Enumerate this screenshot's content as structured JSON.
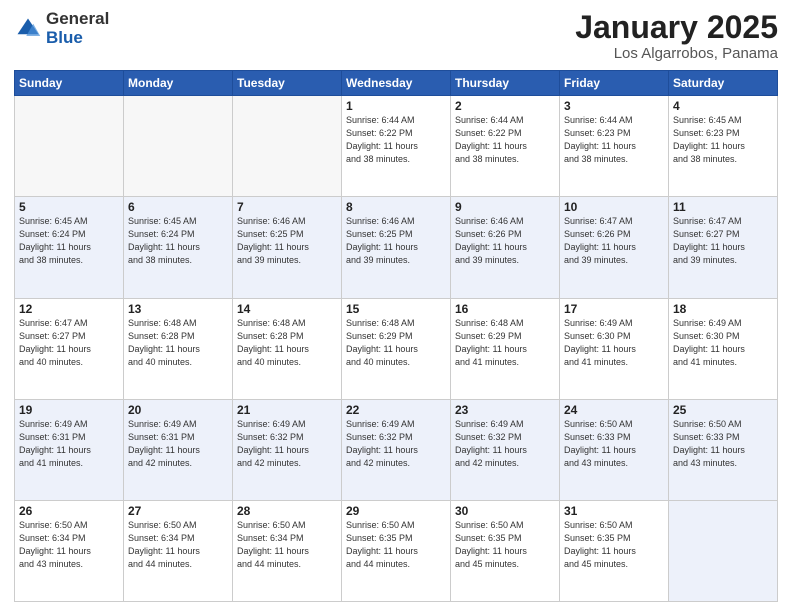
{
  "header": {
    "logo_general": "General",
    "logo_blue": "Blue",
    "title": "January 2025",
    "subtitle": "Los Algarrobos, Panama"
  },
  "days_of_week": [
    "Sunday",
    "Monday",
    "Tuesday",
    "Wednesday",
    "Thursday",
    "Friday",
    "Saturday"
  ],
  "weeks": [
    [
      {
        "day": "",
        "info": ""
      },
      {
        "day": "",
        "info": ""
      },
      {
        "day": "",
        "info": ""
      },
      {
        "day": "1",
        "info": "Sunrise: 6:44 AM\nSunset: 6:22 PM\nDaylight: 11 hours\nand 38 minutes."
      },
      {
        "day": "2",
        "info": "Sunrise: 6:44 AM\nSunset: 6:22 PM\nDaylight: 11 hours\nand 38 minutes."
      },
      {
        "day": "3",
        "info": "Sunrise: 6:44 AM\nSunset: 6:23 PM\nDaylight: 11 hours\nand 38 minutes."
      },
      {
        "day": "4",
        "info": "Sunrise: 6:45 AM\nSunset: 6:23 PM\nDaylight: 11 hours\nand 38 minutes."
      }
    ],
    [
      {
        "day": "5",
        "info": "Sunrise: 6:45 AM\nSunset: 6:24 PM\nDaylight: 11 hours\nand 38 minutes."
      },
      {
        "day": "6",
        "info": "Sunrise: 6:45 AM\nSunset: 6:24 PM\nDaylight: 11 hours\nand 38 minutes."
      },
      {
        "day": "7",
        "info": "Sunrise: 6:46 AM\nSunset: 6:25 PM\nDaylight: 11 hours\nand 39 minutes."
      },
      {
        "day": "8",
        "info": "Sunrise: 6:46 AM\nSunset: 6:25 PM\nDaylight: 11 hours\nand 39 minutes."
      },
      {
        "day": "9",
        "info": "Sunrise: 6:46 AM\nSunset: 6:26 PM\nDaylight: 11 hours\nand 39 minutes."
      },
      {
        "day": "10",
        "info": "Sunrise: 6:47 AM\nSunset: 6:26 PM\nDaylight: 11 hours\nand 39 minutes."
      },
      {
        "day": "11",
        "info": "Sunrise: 6:47 AM\nSunset: 6:27 PM\nDaylight: 11 hours\nand 39 minutes."
      }
    ],
    [
      {
        "day": "12",
        "info": "Sunrise: 6:47 AM\nSunset: 6:27 PM\nDaylight: 11 hours\nand 40 minutes."
      },
      {
        "day": "13",
        "info": "Sunrise: 6:48 AM\nSunset: 6:28 PM\nDaylight: 11 hours\nand 40 minutes."
      },
      {
        "day": "14",
        "info": "Sunrise: 6:48 AM\nSunset: 6:28 PM\nDaylight: 11 hours\nand 40 minutes."
      },
      {
        "day": "15",
        "info": "Sunrise: 6:48 AM\nSunset: 6:29 PM\nDaylight: 11 hours\nand 40 minutes."
      },
      {
        "day": "16",
        "info": "Sunrise: 6:48 AM\nSunset: 6:29 PM\nDaylight: 11 hours\nand 41 minutes."
      },
      {
        "day": "17",
        "info": "Sunrise: 6:49 AM\nSunset: 6:30 PM\nDaylight: 11 hours\nand 41 minutes."
      },
      {
        "day": "18",
        "info": "Sunrise: 6:49 AM\nSunset: 6:30 PM\nDaylight: 11 hours\nand 41 minutes."
      }
    ],
    [
      {
        "day": "19",
        "info": "Sunrise: 6:49 AM\nSunset: 6:31 PM\nDaylight: 11 hours\nand 41 minutes."
      },
      {
        "day": "20",
        "info": "Sunrise: 6:49 AM\nSunset: 6:31 PM\nDaylight: 11 hours\nand 42 minutes."
      },
      {
        "day": "21",
        "info": "Sunrise: 6:49 AM\nSunset: 6:32 PM\nDaylight: 11 hours\nand 42 minutes."
      },
      {
        "day": "22",
        "info": "Sunrise: 6:49 AM\nSunset: 6:32 PM\nDaylight: 11 hours\nand 42 minutes."
      },
      {
        "day": "23",
        "info": "Sunrise: 6:49 AM\nSunset: 6:32 PM\nDaylight: 11 hours\nand 42 minutes."
      },
      {
        "day": "24",
        "info": "Sunrise: 6:50 AM\nSunset: 6:33 PM\nDaylight: 11 hours\nand 43 minutes."
      },
      {
        "day": "25",
        "info": "Sunrise: 6:50 AM\nSunset: 6:33 PM\nDaylight: 11 hours\nand 43 minutes."
      }
    ],
    [
      {
        "day": "26",
        "info": "Sunrise: 6:50 AM\nSunset: 6:34 PM\nDaylight: 11 hours\nand 43 minutes."
      },
      {
        "day": "27",
        "info": "Sunrise: 6:50 AM\nSunset: 6:34 PM\nDaylight: 11 hours\nand 44 minutes."
      },
      {
        "day": "28",
        "info": "Sunrise: 6:50 AM\nSunset: 6:34 PM\nDaylight: 11 hours\nand 44 minutes."
      },
      {
        "day": "29",
        "info": "Sunrise: 6:50 AM\nSunset: 6:35 PM\nDaylight: 11 hours\nand 44 minutes."
      },
      {
        "day": "30",
        "info": "Sunrise: 6:50 AM\nSunset: 6:35 PM\nDaylight: 11 hours\nand 45 minutes."
      },
      {
        "day": "31",
        "info": "Sunrise: 6:50 AM\nSunset: 6:35 PM\nDaylight: 11 hours\nand 45 minutes."
      },
      {
        "day": "",
        "info": ""
      }
    ]
  ]
}
